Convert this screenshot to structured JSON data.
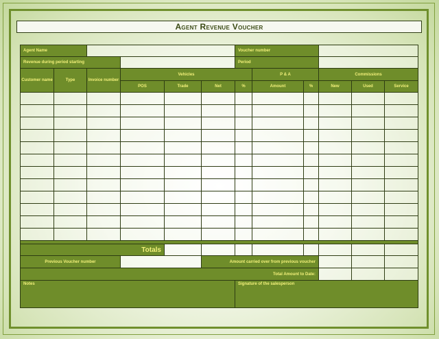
{
  "title": "Agent Revenue Voucher",
  "header": {
    "agent_name_label": "Agent Name",
    "voucher_number_label": "Voucher number",
    "revenue_period_label": "Revenue during period starting",
    "period_label": "Period"
  },
  "columns": {
    "customer_name": "Customer name",
    "type": "Type",
    "invoice_number": "Invoice number",
    "vehicles": "Vehicles",
    "pos": "POS",
    "trade": "Trade",
    "net": "Net",
    "pct": "%",
    "pa": "P & A",
    "amount": "Amount",
    "pa_pct": "%",
    "commissions": "Commissions",
    "new": "New",
    "used": "Used",
    "service": "Service"
  },
  "footer": {
    "totals_label": "Totals",
    "previous_voucher_label": "Previous Voucher number",
    "carried_over_label": "Amount carried over from previous voucher",
    "total_to_date_label": "Total Amount to Date:",
    "notes_label": "Notes",
    "signature_label": "Signature of the salesperson"
  },
  "colors": {
    "header_green": "#6f8d2a",
    "label_yellow": "#f2f07a",
    "border": "#2d3b12"
  }
}
